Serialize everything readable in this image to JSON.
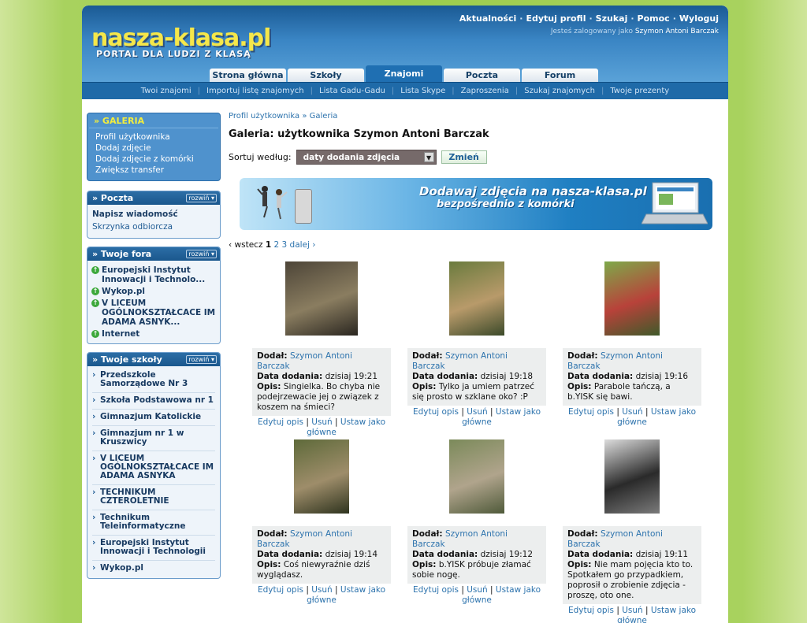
{
  "header": {
    "logo": "nasza-klasa.pl",
    "tagline": "PORTAL DLA LUDZI Z KLASĄ",
    "top_nav": [
      "Aktualności",
      "Edytuj profil",
      "Szukaj",
      "Pomoc",
      "Wyloguj"
    ],
    "user_prefix": "Jesteś zalogowany jako",
    "user_name": "Szymon Antoni Barczak"
  },
  "tabs": [
    {
      "label": "Strona główna",
      "active": false
    },
    {
      "label": "Szkoły",
      "active": false
    },
    {
      "label": "Znajomi",
      "active": true
    },
    {
      "label": "Poczta",
      "active": false
    },
    {
      "label": "Forum",
      "active": false
    }
  ],
  "subnav": [
    "Twoi znajomi",
    "Importuj listę znajomych",
    "Lista Gadu-Gadu",
    "Lista Skype",
    "Zaproszenia",
    "Szukaj znajomych",
    "Twoje prezenty"
  ],
  "sidebar": {
    "gallery": {
      "title": "» GALERIA",
      "links": [
        "Profil użytkownika",
        "Dodaj zdjęcie",
        "Dodaj zdjęcie z komórki",
        "Zwiększ transfer"
      ]
    },
    "poczta": {
      "title": "» Poczta",
      "toggle": "rozwiń ▾",
      "links": [
        "Napisz wiadomość",
        "Skrzynka odbiorcza"
      ]
    },
    "fora": {
      "title": "» Twoje fora",
      "toggle": "rozwiń ▾",
      "items": [
        "Europejski Instytut Innowacji i Technolo...",
        "Wykop.pl",
        "V LICEUM OGÓLNOKSZTAŁCACE IM ADAMA ASNYK...",
        "Internet"
      ]
    },
    "szkoly": {
      "title": "» Twoje szkoły",
      "toggle": "rozwiń ▾",
      "items": [
        "Przedszkole Samorządowe Nr 3",
        "Szkoła Podstawowa nr 1",
        "Gimnazjum Katolickie",
        "Gimnazjum nr 1 w Kruszwicy",
        "V LICEUM OGÓLNOKSZTAŁCACE IM ADAMA ASNYKA",
        "TECHNIKUM CZTEROLETNIE",
        "Technikum Teleinformatyczne",
        "Europejski Instytut Innowacji i Technologii",
        "Wykop.pl"
      ]
    }
  },
  "main": {
    "breadcrumb": "Profil użytkownika » Galeria",
    "title": "Galeria: użytkownika Szymon Antoni Barczak",
    "sort_label": "Sortuj według:",
    "sort_value": "daty dodania zdjęcia",
    "change_button": "Zmień",
    "banner_line1": "Dodawaj zdjęcia na nasza-klasa.pl",
    "banner_line2": "bezpośrednio z komórki",
    "pager": {
      "prev": "‹ wstecz",
      "current": "1",
      "pages": [
        "2",
        "3"
      ],
      "next": "dalej ›"
    },
    "labels": {
      "added_by": "Dodał:",
      "date": "Data dodania:",
      "desc": "Opis:"
    },
    "actions": {
      "edit": "Edytuj opis",
      "delete": "Usuń",
      "set_main": "Ustaw jako główne"
    },
    "photos": [
      {
        "author": "Szymon Antoni Barczak",
        "date": "dzisiaj 19:21",
        "desc": "Singielka. Bo chyba nie podejrzewacie jej o związek z koszem na śmieci?",
        "colors": [
          "#4d4538",
          "#8a7d60",
          "#2a2620"
        ]
      },
      {
        "author": "Szymon Antoni Barczak",
        "date": "dzisiaj 19:18",
        "desc": "Tylko ja umiem patrzeć się prosto w szklane oko? :P",
        "colors": [
          "#6a7b3e",
          "#b89a6a",
          "#3c4a2a"
        ]
      },
      {
        "author": "Szymon Antoni Barczak",
        "date": "dzisiaj 19:16",
        "desc": "Parabole tańczą, a b.YISK się bawi.",
        "colors": [
          "#7ea94a",
          "#b8423a",
          "#3f5a2a"
        ]
      },
      {
        "author": "Szymon Antoni Barczak",
        "date": "dzisiaj 19:14",
        "desc": "Coś niewyraźnie dziś wyglądasz.",
        "colors": [
          "#5e6a3a",
          "#9e8d6a",
          "#2e331e"
        ]
      },
      {
        "author": "Szymon Antoni Barczak",
        "date": "dzisiaj 19:12",
        "desc": "b.YISK próbuje złamać sobie nogę.",
        "colors": [
          "#7b8a5a",
          "#b0a48c",
          "#4f5a3a"
        ]
      },
      {
        "author": "Szymon Antoni Barczak",
        "date": "dzisiaj 19:11",
        "desc": "Nie mam pojęcia kto to. Spotkałem go przypadkiem, poprosił o zrobienie zdjęcia - proszę, oto one.",
        "colors": [
          "#dcdcdc",
          "#2a2a2a",
          "#7a7a7a"
        ]
      }
    ]
  }
}
